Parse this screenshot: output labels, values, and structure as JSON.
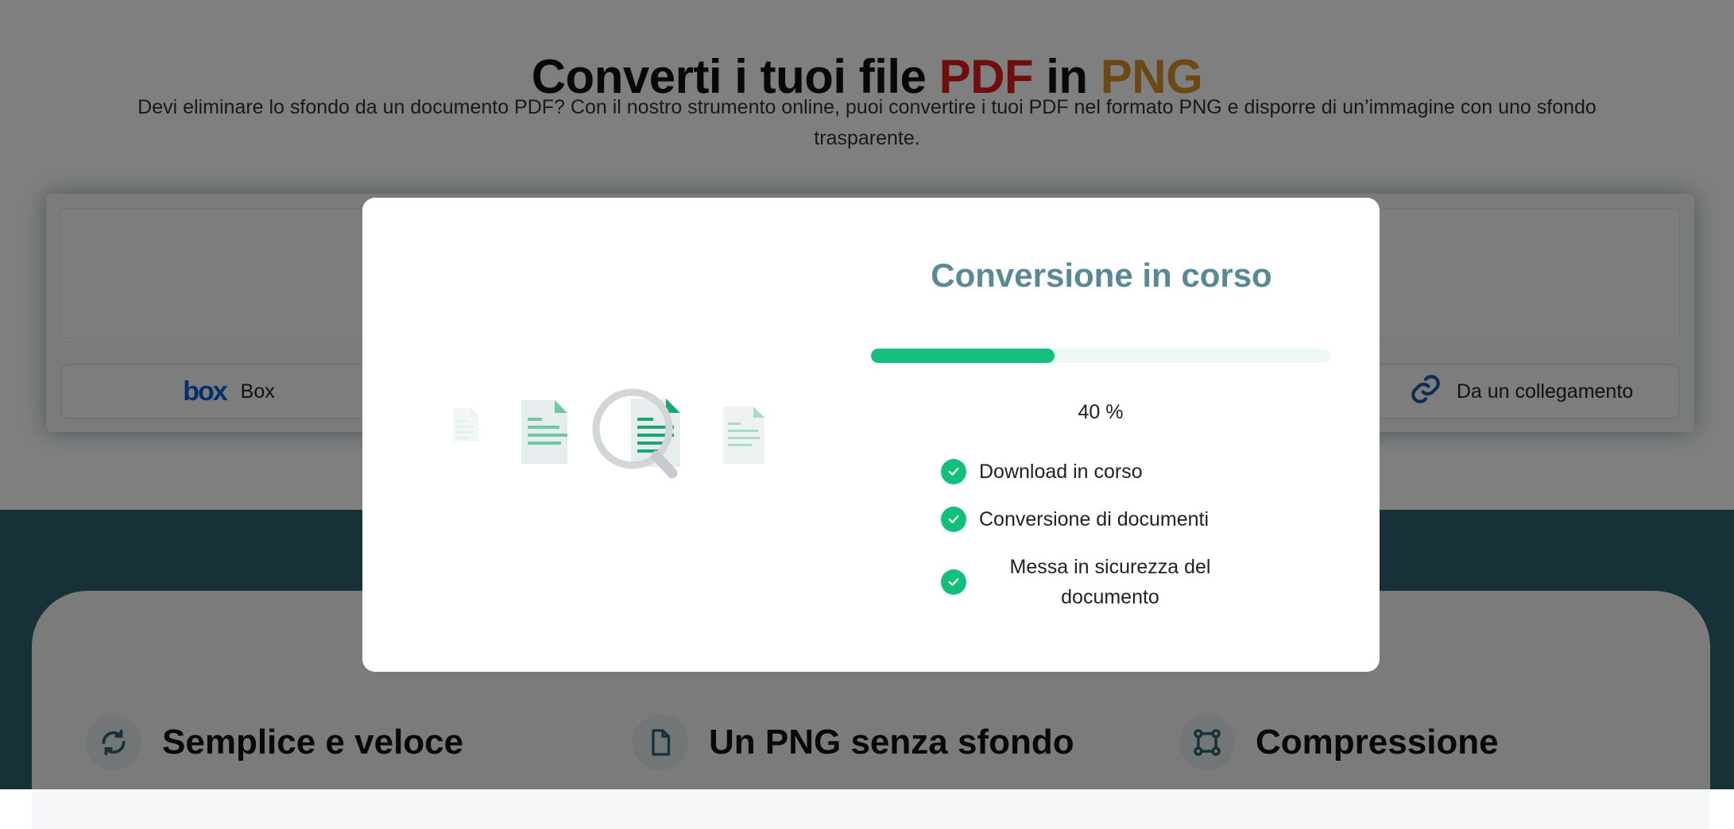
{
  "page": {
    "title_prefix": "Converti i tuoi file ",
    "title_pdf": "PDF",
    "title_middle": " in ",
    "title_png": "PNG",
    "subtitle": "Devi eliminare lo sfondo da un documento PDF? Con il nostro strumento online, puoi convertire i tuoi PDF nel formato PNG e disporre di un’immagine con uno sfondo trasparente.",
    "source_buttons": {
      "box_logo": "box",
      "box_label": "Box",
      "link_label": "Da un collegamento"
    },
    "features": [
      {
        "label": "Semplice e veloce",
        "icon": "refresh-icon"
      },
      {
        "label": "Un PNG senza sfondo",
        "icon": "file-icon"
      },
      {
        "label": "Compressione",
        "icon": "compress-icon"
      }
    ]
  },
  "modal": {
    "title": "Conversione in corso",
    "progress_value": 40,
    "progress_text": "40 %",
    "steps": [
      {
        "label": "Download in corso",
        "done": true
      },
      {
        "label": "Conversione di documenti",
        "done": true
      },
      {
        "label": "Messa in sicurezza del documento",
        "done": true
      }
    ]
  },
  "colors": {
    "accent_green": "#12bf7c",
    "title_teal": "#5a8996",
    "pdf_red": "#e11d1d",
    "png_orange": "#d9902a",
    "band_teal": "#2d6471"
  }
}
